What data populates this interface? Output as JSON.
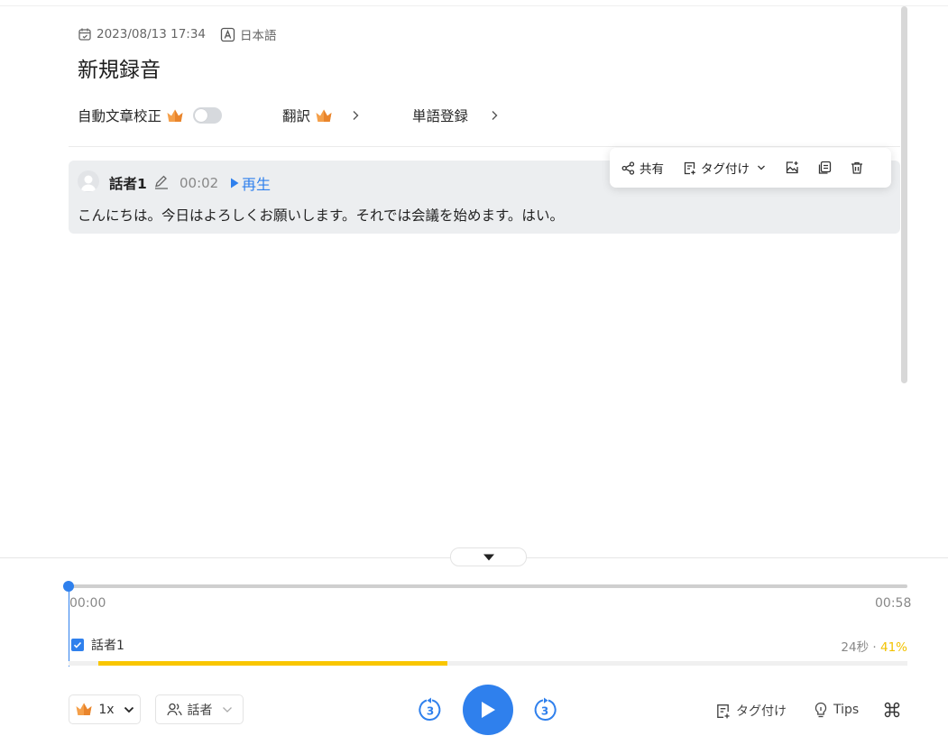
{
  "header": {
    "datetime": "2023/08/13 17:34",
    "language": "日本語",
    "title": "新規録音"
  },
  "options": {
    "auto_correct_label": "自動文章校正",
    "auto_correct_enabled": false,
    "translate_label": "翻訳",
    "dictionary_label": "単語登録"
  },
  "segment": {
    "speaker": "話者1",
    "timestamp": "00:02",
    "play_label": "再生",
    "text": "こんにちは。今日はよろしくお願いします。それでは会議を始めます。はい。"
  },
  "popup": {
    "share_label": "共有",
    "tag_label": "タグ付け"
  },
  "timeline": {
    "current_time": "00:00",
    "total_time": "00:58",
    "progress": 0
  },
  "speaker_stats": {
    "speaker": "話者1",
    "checked": true,
    "duration": "24秒",
    "percent_label": "41%",
    "bar_start": 0.035,
    "bar_end": 0.452
  },
  "controls": {
    "speed": "1x",
    "speaker_filter": "話者",
    "skip_back": "3",
    "skip_forward": "3",
    "tag_label": "タグ付け",
    "tips_label": "Tips"
  },
  "colors": {
    "accent": "#2f80ed",
    "crown": "#f5a04a",
    "speaker_bar": "#f9c600"
  }
}
